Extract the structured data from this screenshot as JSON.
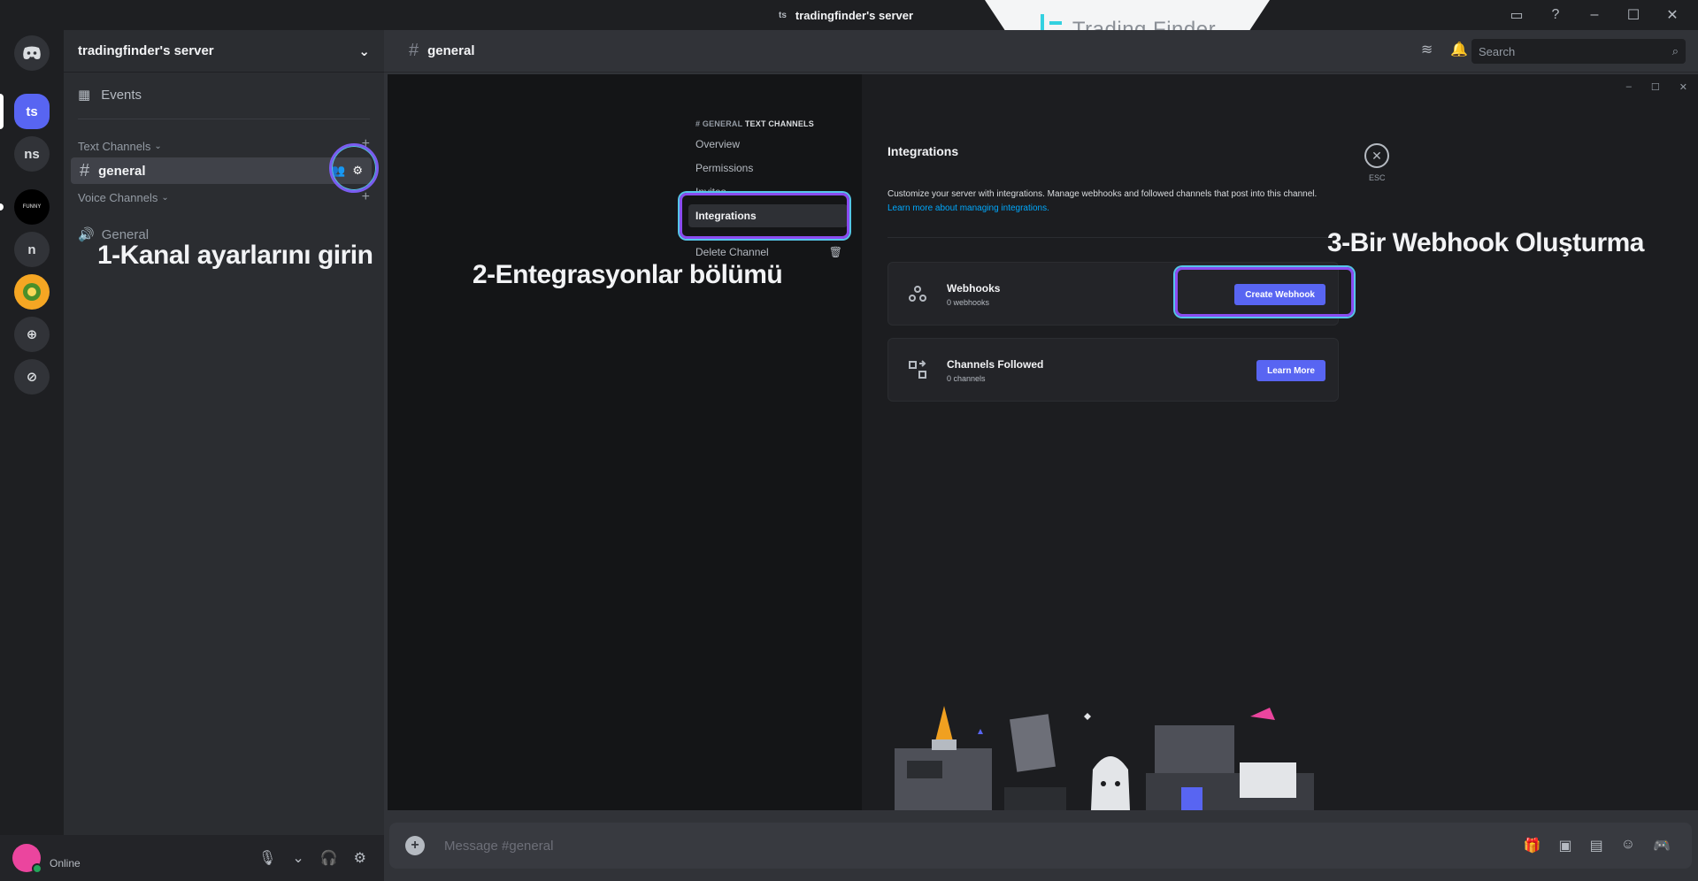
{
  "titlebar": {
    "mini": "ts",
    "server_name": "tradingfinder's server"
  },
  "logo": {
    "text": "Trading Finder"
  },
  "rail": {
    "guilds": [
      "ts",
      "ns",
      "FUNNY",
      "n"
    ]
  },
  "sidebar": {
    "server_name": "tradingfinder's server",
    "events": "Events",
    "text_category": "Text Channels",
    "channel": "general",
    "voice_category": "Voice Channels",
    "voice_channel": "General"
  },
  "annotations": {
    "step1": "1-Kanal ayarlarını girin",
    "step2": "2-Entegrasyonlar bölümü",
    "step3": "3-Bir Webhook Oluşturma"
  },
  "user_panel": {
    "status": "Online"
  },
  "chat": {
    "channel": "general",
    "search_placeholder": "Search",
    "composer_placeholder": "Message #general"
  },
  "settings_nav": {
    "title_prefix": "# GENERAL",
    "title_suffix": "TEXT CHANNELS",
    "items": [
      "Overview",
      "Permissions",
      "Invites",
      "Integrations",
      "Delete Channel"
    ]
  },
  "integrations": {
    "title": "Integrations",
    "description": "Customize your server with integrations. Manage webhooks and followed channels that post into this channel.",
    "link": "Learn more about managing integrations.",
    "esc": "ESC",
    "webhooks": {
      "title": "Webhooks",
      "sub": "0 webhooks",
      "button": "Create Webhook"
    },
    "followed": {
      "title": "Channels Followed",
      "sub": "0 channels",
      "button": "Learn More"
    }
  },
  "colors": {
    "accent": "#5865f2",
    "highlight": "#8a4cf0",
    "online": "#23a55a"
  }
}
